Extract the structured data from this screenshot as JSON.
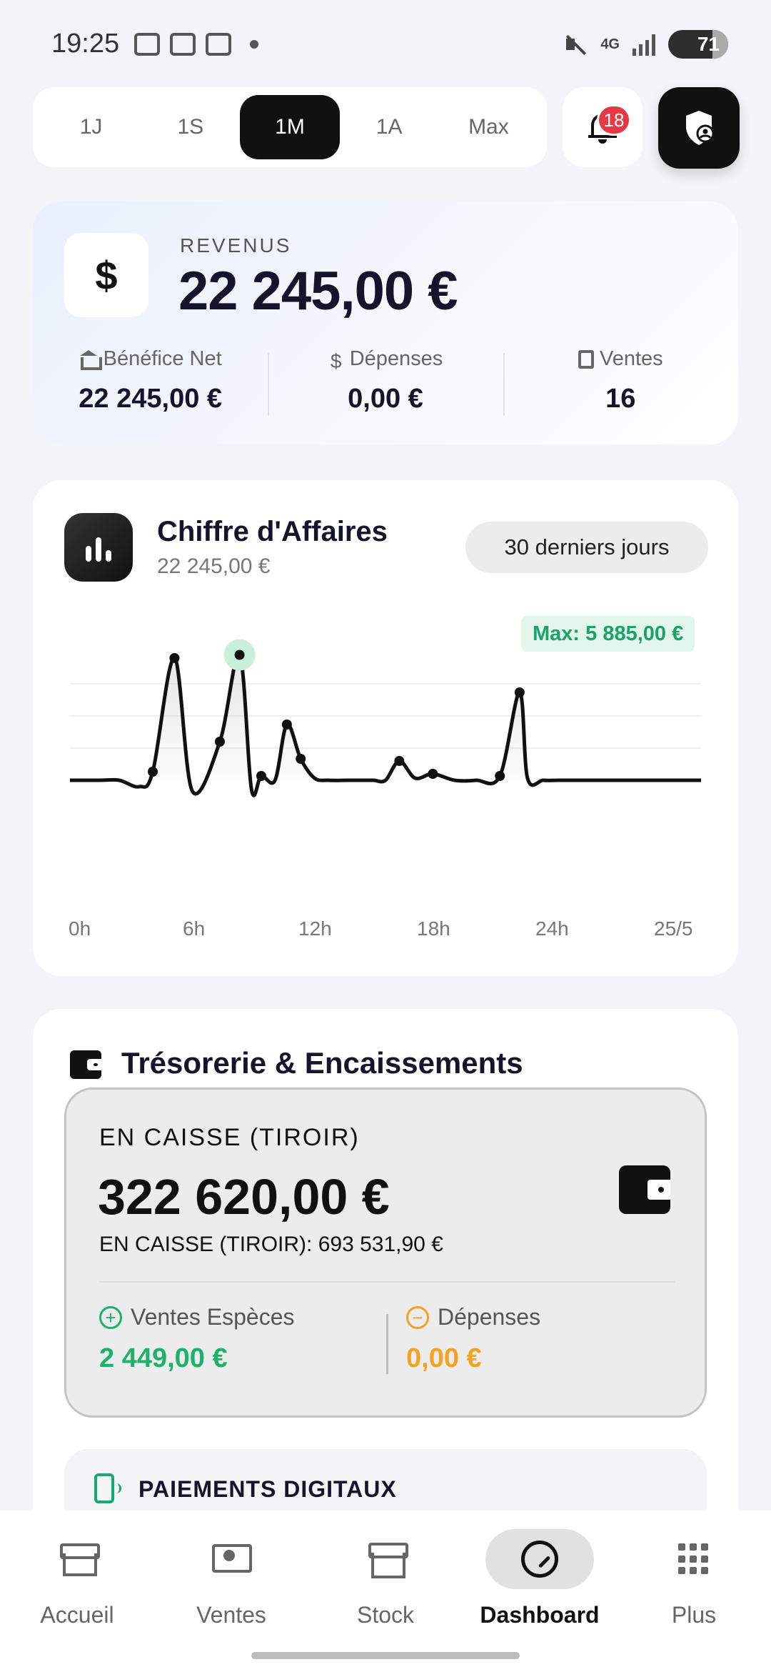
{
  "status_bar": {
    "time": "19:25",
    "network": "4G",
    "battery": "71"
  },
  "period": {
    "options": [
      "1J",
      "1S",
      "1M",
      "1A",
      "Max"
    ],
    "selected": "1M"
  },
  "notifications": {
    "count": "18"
  },
  "revenue": {
    "label": "REVENUS",
    "value": "22 245,00 €",
    "stats": [
      {
        "label": "Bénéfice Net",
        "value": "22 245,00 €",
        "icon": "bank-icon"
      },
      {
        "label": "Dépenses",
        "value": "0,00 €",
        "icon": "no-money-icon"
      },
      {
        "label": "Ventes",
        "value": "16",
        "icon": "receipt-icon"
      }
    ]
  },
  "chart_card": {
    "title": "Chiffre d'Affaires",
    "subtitle": "22 245,00 €",
    "range": "30 derniers jours",
    "max_label": "Max: 5 885,00 €"
  },
  "chart_data": {
    "type": "line",
    "x_ticks": [
      "0h",
      "6h",
      "12h",
      "18h",
      "24h",
      "25/5"
    ],
    "x": [
      0,
      1.5,
      2.5,
      3.5,
      4.2,
      5.3,
      6.2,
      7.6,
      8.6,
      9.2,
      9.7,
      10.4,
      11.0,
      11.7,
      12.4,
      13.1,
      14.1,
      14.8,
      15.4,
      16.0,
      16.7,
      17.5,
      18.4,
      19.5,
      20.6,
      21.8,
      22.8,
      23.2,
      24.0,
      24.8,
      25.6,
      26.4,
      27.5,
      28.3,
      29.4,
      30.4,
      31.2,
      32.0
    ],
    "values": [
      0,
      0,
      0,
      -300,
      400,
      5700,
      -500,
      1800,
      5850,
      -400,
      200,
      0,
      2600,
      1000,
      100,
      0,
      0,
      0,
      0,
      0,
      900,
      100,
      300,
      0,
      0,
      200,
      4100,
      100,
      0,
      0,
      0,
      0,
      0,
      0,
      0,
      0,
      0,
      0
    ],
    "highlight_x": 8.6,
    "max_value": 5885
  },
  "treasury": {
    "title": "Trésorerie & Encaissements",
    "cash_label": "EN CAISSE (TIROIR)",
    "cash_value": "322 620,00 €",
    "cash_sub": "EN CAISSE (TIROIR): 693 531,90 €",
    "cash_sales_label": "Ventes Espèces",
    "cash_sales_value": "2 449,00 €",
    "expenses_label": "Dépenses",
    "expenses_value": "0,00 €",
    "digital_label": "PAIEMENTS DIGITAUX"
  },
  "nav": {
    "items": [
      {
        "label": "Accueil",
        "icon": "store-icon"
      },
      {
        "label": "Ventes",
        "icon": "sales-icon"
      },
      {
        "label": "Stock",
        "icon": "box-icon"
      },
      {
        "label": "Dashboard",
        "icon": "gauge-icon"
      },
      {
        "label": "Plus",
        "icon": "grid-icon"
      }
    ],
    "active": "Dashboard"
  },
  "colors": {
    "accent": "#111111",
    "positive": "#1fb06b",
    "warning": "#f2a322",
    "badge": "#e53945"
  }
}
